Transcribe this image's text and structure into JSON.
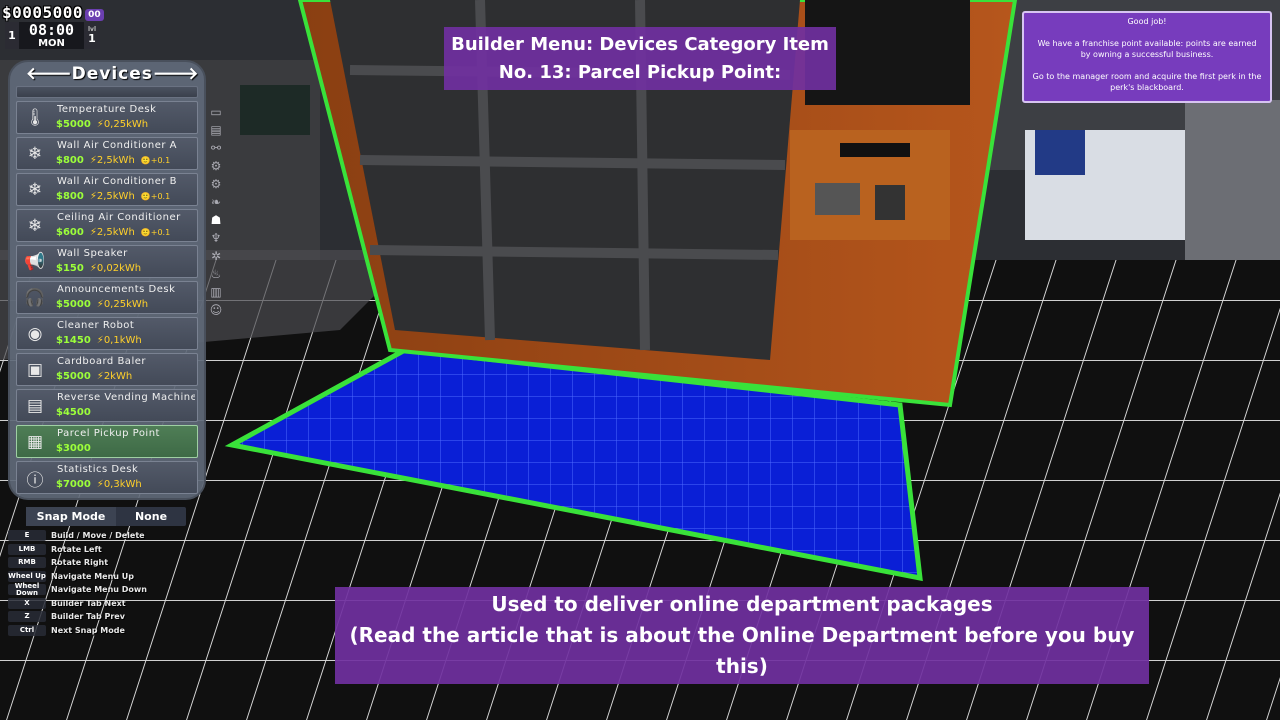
{
  "hud": {
    "money": "$0005000",
    "money_cents": "00",
    "day_number": "1",
    "time": "08:00",
    "weekday": "MON",
    "level_label": "lvl",
    "level": "1"
  },
  "builder": {
    "category_title": "Devices",
    "prev_arrow": "🡐",
    "next_arrow": "🡒",
    "items": [
      {
        "name": "Temperature Desk",
        "price": "$5000",
        "power": "⚡0,25kWh",
        "extra": "",
        "icon": "thermometer-icon",
        "glyph": "🌡",
        "selected": false
      },
      {
        "name": "Wall Air Conditioner A",
        "price": "$800",
        "power": "⚡2,5kWh",
        "extra": "🙂+0.1",
        "icon": "air-conditioner-icon",
        "glyph": "❄",
        "selected": false
      },
      {
        "name": "Wall Air Conditioner B",
        "price": "$800",
        "power": "⚡2,5kWh",
        "extra": "🙂+0.1",
        "icon": "air-conditioner-icon",
        "glyph": "❄",
        "selected": false
      },
      {
        "name": "Ceiling Air Conditioner",
        "price": "$600",
        "power": "⚡2,5kWh",
        "extra": "🙂+0.1",
        "icon": "air-conditioner-icon",
        "glyph": "❄",
        "selected": false
      },
      {
        "name": "Wall Speaker",
        "price": "$150",
        "power": "⚡0,02kWh",
        "extra": "",
        "icon": "megaphone-icon",
        "glyph": "📢",
        "selected": false
      },
      {
        "name": "Announcements Desk",
        "price": "$5000",
        "power": "⚡0,25kWh",
        "extra": "",
        "icon": "headset-icon",
        "glyph": "🎧",
        "selected": false
      },
      {
        "name": "Cleaner Robot",
        "price": "$1450",
        "power": "⚡0,1kWh",
        "extra": "",
        "icon": "robot-icon",
        "glyph": "◉",
        "selected": false
      },
      {
        "name": "Cardboard Baler",
        "price": "$5000",
        "power": "⚡2kWh",
        "extra": "",
        "icon": "box-icon",
        "glyph": "▣",
        "selected": false
      },
      {
        "name": "Reverse Vending Machine",
        "price": "$4500",
        "power": "",
        "extra": "",
        "icon": "vending-machine-icon",
        "glyph": "▤",
        "selected": false
      },
      {
        "name": "Parcel Pickup Point",
        "price": "$3000",
        "power": "",
        "extra": "",
        "icon": "parcel-icon",
        "glyph": "▦",
        "selected": true
      },
      {
        "name": "Statistics Desk",
        "price": "$7000",
        "power": "⚡0,3kWh",
        "extra": "",
        "icon": "info-icon",
        "glyph": "ⓘ",
        "selected": false
      }
    ],
    "snap_label": "Snap Mode",
    "snap_value": "None",
    "keys": [
      {
        "key": "E",
        "desc": "Build / Move / Delete"
      },
      {
        "key": "LMB",
        "desc": "Rotate Left"
      },
      {
        "key": "RMB",
        "desc": "Rotate Right"
      },
      {
        "key": "Wheel Up",
        "desc": "Navigate Menu Up"
      },
      {
        "key": "Wheel Down",
        "desc": "Navigate Menu Down"
      },
      {
        "key": "X",
        "desc": "Builder Tab Next"
      },
      {
        "key": "Z",
        "desc": "Builder Tab Prev"
      },
      {
        "key": "Ctrl",
        "desc": "Next Snap Mode"
      }
    ]
  },
  "caption_top": {
    "line1": "Builder Menu: Devices Category Item",
    "line2": "No. 13: Parcel Pickup Point:"
  },
  "caption_bottom": {
    "line1": "Used to deliver online department packages",
    "line2": "(Read the article that is about the Online Department before you buy",
    "line3": "this)"
  },
  "notification": {
    "title": "Good job!",
    "body1": "We have a franchise point available: points are earned by owning a successful business.",
    "body2": "Go to the manager room and acquire the first perk in the perk's blackboard."
  },
  "colors": {
    "caption_bg": "#7030a0",
    "price": "#9cff3a",
    "power": "#ffd02a",
    "placement_grid": "#0a1fd6",
    "outline": "#39e23a"
  }
}
